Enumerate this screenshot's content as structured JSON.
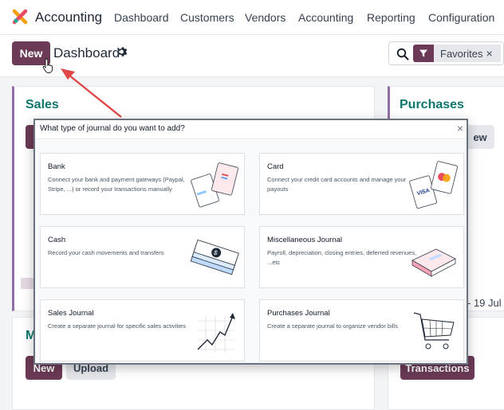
{
  "navbar": {
    "app_name": "Accounting",
    "menu": [
      "Dashboard",
      "Customers",
      "Vendors",
      "Accounting",
      "Reporting",
      "Configuration"
    ]
  },
  "control_panel": {
    "new_label": "New",
    "title": "Dashboard",
    "favorites_label": "Favorites",
    "favorites_remove": "×"
  },
  "background": {
    "sales_title": "Sales",
    "purchases_title": "Purchases",
    "second_left_title_partial": "M",
    "new_label": "New",
    "upload_label": "Upload",
    "new_partial": "ew",
    "transactions_label": "Transactions",
    "date_partial": "- 19 Jul"
  },
  "dialog": {
    "title": "What type of journal do you want to add?",
    "close": "×",
    "cards": [
      {
        "title": "Bank",
        "desc": "Connect your bank and payment gateways (Paypal, Stripe, ...) or record your transactions manually",
        "icon": "bank-cards-icon"
      },
      {
        "title": "Card",
        "desc": "Connect your credit card accounts and manage your payouts",
        "icon": "credit-cards-icon"
      },
      {
        "title": "Cash",
        "desc": "Record your cash movements and transfers",
        "icon": "cash-bundle-icon"
      },
      {
        "title": "Miscellaneous Journal",
        "desc": "Payroll, depreciation, closing entries, deferred revenues, ...etc",
        "icon": "book-icon"
      },
      {
        "title": "Sales Journal",
        "desc": "Create a separate journal for specific sales activities",
        "icon": "growth-chart-icon"
      },
      {
        "title": "Purchases Journal",
        "desc": "Create a separate journal to organize vendor bills",
        "icon": "shopping-cart-icon"
      }
    ]
  },
  "colors": {
    "primary": "#6b3a56",
    "teal_title": "#0f766e",
    "accent_border": "#8f6ea8",
    "arrow": "#e04848"
  }
}
